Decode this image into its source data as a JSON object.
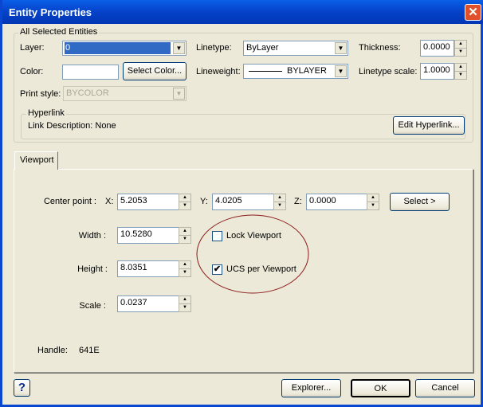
{
  "window": {
    "title": "Entity Properties",
    "close": "✕"
  },
  "all": {
    "group_label": "All Selected Entities",
    "layer_label": "Layer:",
    "layer_value": "0",
    "linetype_label": "Linetype:",
    "linetype_value": "ByLayer",
    "thickness_label": "Thickness:",
    "thickness_value": "0.0000",
    "color_label": "Color:",
    "select_color": "Select Color...",
    "lineweight_label": "Lineweight:",
    "lineweight_value": "BYLAYER",
    "linetype_scale_label": "Linetype scale:",
    "linetype_scale_value": "1.0000",
    "print_style_label": "Print style:",
    "print_style_value": "BYCOLOR"
  },
  "hyperlink": {
    "group_label": "Hyperlink",
    "description": "Link Description: None",
    "edit": "Edit Hyperlink..."
  },
  "tab": {
    "label": "Viewport"
  },
  "viewport": {
    "center_label": "Center point :",
    "x_label": "X:",
    "x": "5.2053",
    "y_label": "Y:",
    "y": "4.0205",
    "z_label": "Z:",
    "z": "0.0000",
    "select": "Select >",
    "width_label": "Width :",
    "width": "10.5280",
    "height_label": "Height :",
    "height": "8.0351",
    "scale_label": "Scale :",
    "scale": "0.0237",
    "lock_label": "Lock Viewport",
    "lock_checked": false,
    "ucs_label": "UCS per Viewport",
    "ucs_checked": true,
    "handle_label": "Handle:",
    "handle": "641E"
  },
  "buttons": {
    "help": "?",
    "explorer": "Explorer...",
    "ok": "OK",
    "cancel": "Cancel"
  },
  "colors": {
    "title_bar": "#0542C8",
    "annotation_ellipse": "#8B1A1A",
    "selection": "#316AC5"
  }
}
